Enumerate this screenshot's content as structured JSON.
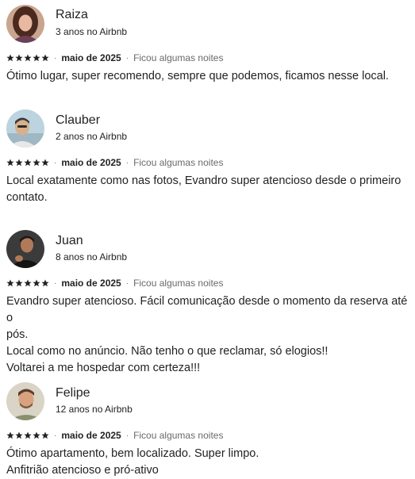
{
  "reviews": [
    {
      "name": "Raiza",
      "tenure": "3 anos no Airbnb",
      "rating": 5,
      "date": "maio de 2025",
      "stay": "Ficou algumas noites",
      "lines": [
        "Ótimo lugar, super recomendo, sempre que podemos, ficamos nesse local."
      ],
      "avatar_colors": {
        "bg": "#c9a48f",
        "hair": "#4a2a1e",
        "skin": "#e8b9a0",
        "shirt": "#6b3f56"
      }
    },
    {
      "name": "Clauber",
      "tenure": "2 anos no Airbnb",
      "rating": 5,
      "date": "maio de 2025",
      "stay": "Ficou algumas noites",
      "lines": [
        "Local exatamente como nas fotos, Evandro super atencioso desde o primeiro",
        "contato."
      ],
      "avatar_colors": {
        "bg": "#bcd4df",
        "hair": "#3a3a3a",
        "skin": "#d8b08c",
        "shirt": "#e8e8e8"
      }
    },
    {
      "name": "Juan",
      "tenure": "8 anos no Airbnb",
      "rating": 5,
      "date": "maio de 2025",
      "stay": "Ficou algumas noites",
      "lines": [
        "Evandro super atencioso. Fácil comunicação desde o momento da reserva até o",
        "pós.",
        "Local como no anúncio. Não tenho o que reclamar, só elogios!!",
        "Voltarei a me hospedar com certeza!!!"
      ],
      "avatar_colors": {
        "bg": "#3b3b3b",
        "hair": "#1e1a18",
        "skin": "#b07a5a",
        "shirt": "#151515"
      }
    },
    {
      "name": "Felipe",
      "tenure": "12 anos no Airbnb",
      "rating": 5,
      "date": "maio de 2025",
      "stay": "Ficou algumas noites",
      "lines": [
        "Ótimo apartamento, bem localizado. Super limpo.",
        "Anfitrião atencioso e pró-ativo"
      ],
      "avatar_colors": {
        "bg": "#d9d4c5",
        "hair": "#5a3e2b",
        "skin": "#d9a27e",
        "shirt": "#8a8f6e"
      }
    }
  ],
  "separator": "·",
  "star_color": "#222222"
}
